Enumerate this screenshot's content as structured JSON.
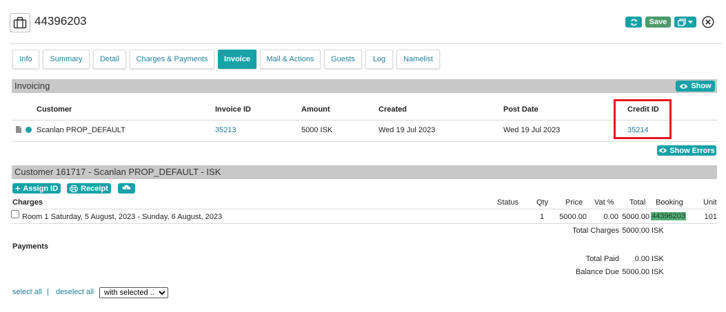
{
  "header": {
    "title": "44396203",
    "save_label": "Save"
  },
  "tabs": [
    {
      "label": "Info"
    },
    {
      "label": "Summary"
    },
    {
      "label": "Detail"
    },
    {
      "label": "Charges & Payments"
    },
    {
      "label": "Invoice"
    },
    {
      "label": "Mail & Actions"
    },
    {
      "label": "Guests"
    },
    {
      "label": "Log"
    },
    {
      "label": "Namelist"
    }
  ],
  "active_tab": "Invoice",
  "invoicing": {
    "title": "Invoicing",
    "show_label": "Show",
    "columns": {
      "customer": "Customer",
      "invoice_id": "Invoice ID",
      "amount": "Amount",
      "created": "Created",
      "post_date": "Post Date",
      "credit_id": "Credit ID"
    },
    "row": {
      "customer": "Scanlan PROP_DEFAULT",
      "invoice_id": "35213",
      "amount": "5000 ISK",
      "created": "Wed 19 Jul 2023",
      "post_date": "Wed 19 Jul 2023",
      "credit_id": "35214"
    },
    "show_errors_label": "Show Errors"
  },
  "customer_section": {
    "title": "Customer 161717 - Scanlan PROP_DEFAULT - ISK",
    "assign_id_label": "Assign ID",
    "receipt_label": "Receipt",
    "charges": {
      "title": "Charges",
      "columns": {
        "status": "Status",
        "qty": "Qty",
        "price": "Price",
        "vat": "Vat %",
        "total": "Total",
        "booking": "Booking",
        "unit": "Unit"
      },
      "row": {
        "description": "Room 1 Saturday, 5 August, 2023 - Sunday, 6 August, 2023",
        "qty": "1",
        "price": "5000.00",
        "vat": "0.00",
        "total": "5000.00",
        "booking": "44396203",
        "unit": "101"
      },
      "total_charges_label": "Total Charges",
      "total_charges_value": "5000.00",
      "currency": "ISK"
    },
    "payments": {
      "title": "Payments",
      "total_paid_label": "Total Paid",
      "total_paid_value": "0.00",
      "balance_due_label": "Balance Due",
      "balance_due_value": "5000.00",
      "currency": "ISK"
    }
  },
  "footer": {
    "select_all": "select all",
    "separator": "|",
    "deselect_all": "deselect all",
    "with_selected": "with selected ..."
  },
  "colors": {
    "accent": "#17a2a8",
    "save_green": "#4d9a69",
    "highlight_red": "#e8141c",
    "booking_highlight": "#55b07a"
  }
}
